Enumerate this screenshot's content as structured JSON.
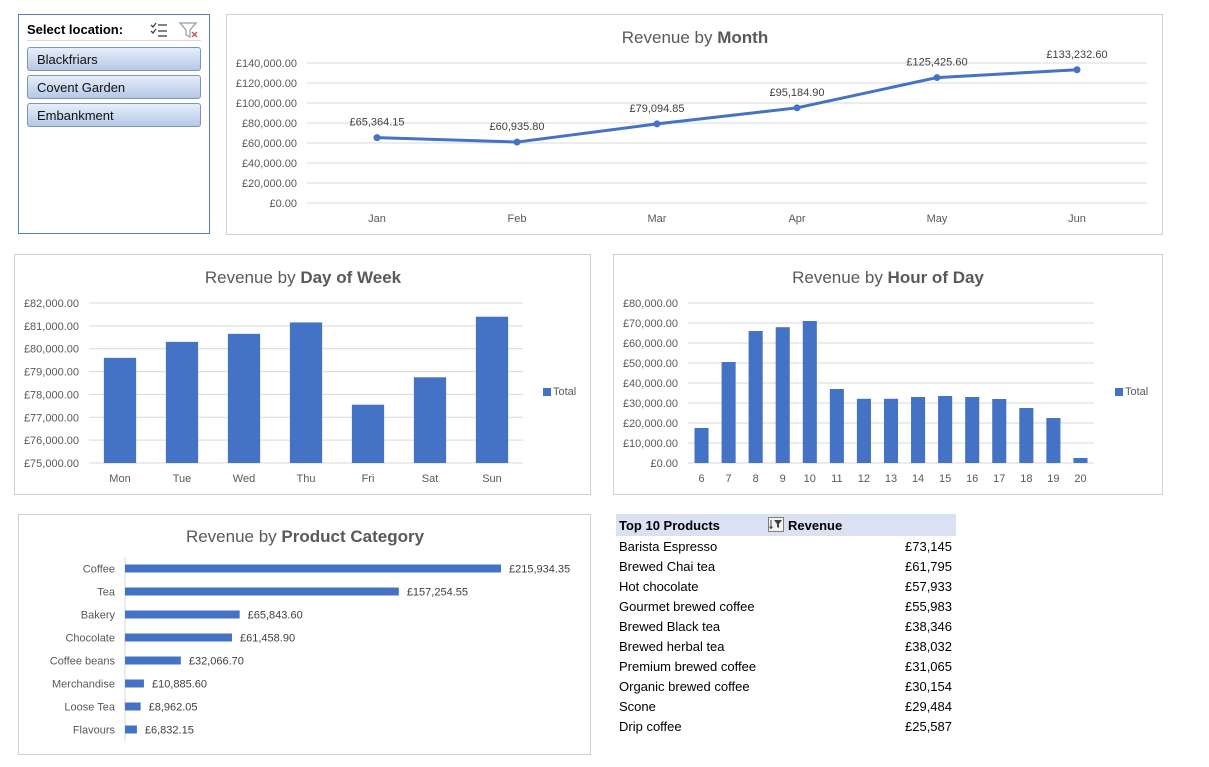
{
  "slicer": {
    "title": "Select location:",
    "items": [
      {
        "label": "Blackfriars"
      },
      {
        "label": "Covent Garden"
      },
      {
        "label": "Embankment"
      }
    ]
  },
  "colors": {
    "series": "#4472c4",
    "grid": "#d9d9d9",
    "text": "#595959"
  },
  "chart_data": [
    {
      "id": "month",
      "type": "line",
      "title_prefix": "Revenue by ",
      "title_bold": "Month",
      "categories": [
        "Jan",
        "Feb",
        "Mar",
        "Apr",
        "May",
        "Jun"
      ],
      "values": [
        65364.15,
        60935.8,
        79094.85,
        95184.9,
        125425.6,
        133232.6
      ],
      "data_labels": [
        "£65,364.15",
        "£60,935.80",
        "£79,094.85",
        "£95,184.90",
        "£125,425.60",
        "£133,232.60"
      ],
      "ylim": [
        0,
        140000
      ],
      "yticks": [
        "£0.00",
        "£20,000.00",
        "£40,000.00",
        "£60,000.00",
        "£80,000.00",
        "£100,000.00",
        "£120,000.00",
        "£140,000.00"
      ],
      "grid": true
    },
    {
      "id": "dow",
      "type": "bar",
      "title_prefix": "Revenue by ",
      "title_bold": "Day of Week",
      "categories": [
        "Mon",
        "Tue",
        "Wed",
        "Thu",
        "Fri",
        "Sat",
        "Sun"
      ],
      "values": [
        79600,
        80300,
        80650,
        81150,
        77550,
        78750,
        81400
      ],
      "ylim": [
        75000,
        82000
      ],
      "yticks": [
        "£75,000.00",
        "£76,000.00",
        "£77,000.00",
        "£78,000.00",
        "£79,000.00",
        "£80,000.00",
        "£81,000.00",
        "£82,000.00"
      ],
      "legend": "Total",
      "legend_position": "right",
      "grid": true
    },
    {
      "id": "hour",
      "type": "bar",
      "title_prefix": "Revenue by ",
      "title_bold": "Hour of Day",
      "categories": [
        "6",
        "7",
        "8",
        "9",
        "10",
        "11",
        "12",
        "13",
        "14",
        "15",
        "16",
        "17",
        "18",
        "19",
        "20"
      ],
      "values": [
        17500,
        50500,
        66000,
        67900,
        71000,
        37000,
        32100,
        32100,
        33000,
        33500,
        33000,
        32000,
        27500,
        22500,
        2500
      ],
      "ylim": [
        0,
        80000
      ],
      "yticks": [
        "£0.00",
        "£10,000.00",
        "£20,000.00",
        "£30,000.00",
        "£40,000.00",
        "£50,000.00",
        "£60,000.00",
        "£70,000.00",
        "£80,000.00"
      ],
      "legend": "Total",
      "legend_position": "right",
      "grid": true
    },
    {
      "id": "category",
      "type": "bar",
      "orientation": "horizontal",
      "title_prefix": "Revenue by ",
      "title_bold": "Product Category",
      "categories": [
        "Coffee",
        "Tea",
        "Bakery",
        "Chocolate",
        "Coffee beans",
        "Merchandise",
        "Loose Tea",
        "Flavours"
      ],
      "values": [
        215934.35,
        157254.55,
        65843.6,
        61458.9,
        32066.7,
        10885.6,
        8962.05,
        6832.15
      ],
      "data_labels": [
        "£215,934.35",
        "£157,254.55",
        "£65,843.60",
        "£61,458.90",
        "£32,066.70",
        "£10,885.60",
        "£8,962.05",
        "£6,832.15"
      ],
      "grid": false
    }
  ],
  "table": {
    "header_product": "Top 10 Products",
    "header_revenue": "Revenue",
    "rows": [
      {
        "name": "Barista Espresso",
        "revenue": "£73,145"
      },
      {
        "name": "Brewed Chai tea",
        "revenue": "£61,795"
      },
      {
        "name": "Hot chocolate",
        "revenue": "£57,933"
      },
      {
        "name": "Gourmet brewed coffee",
        "revenue": "£55,983"
      },
      {
        "name": "Brewed Black tea",
        "revenue": "£38,346"
      },
      {
        "name": "Brewed herbal tea",
        "revenue": "£38,032"
      },
      {
        "name": "Premium brewed coffee",
        "revenue": "£31,065"
      },
      {
        "name": "Organic brewed coffee",
        "revenue": "£30,154"
      },
      {
        "name": "Scone",
        "revenue": "£29,484"
      },
      {
        "name": "Drip coffee",
        "revenue": "£25,587"
      }
    ]
  }
}
